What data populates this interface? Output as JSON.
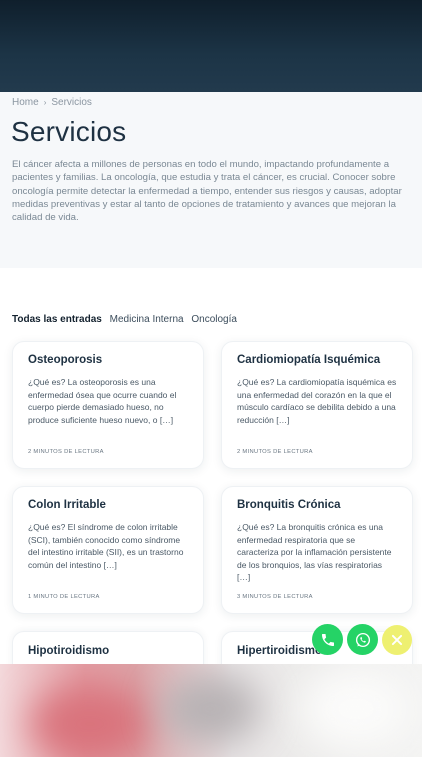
{
  "breadcrumb": {
    "home": "Home",
    "current": "Servicios"
  },
  "page": {
    "title": "Servicios",
    "description": "El cáncer afecta a millones de personas en todo el mundo, impactando profundamente a pacientes y familias. La oncología, que estudia y trata el cáncer, es crucial. Conocer sobre oncología permite detectar la enfermedad a tiempo, entender sus riesgos y causas, adoptar medidas preventivas y estar al tanto de opciones de tratamiento y avances que mejoran la calidad de vida."
  },
  "filters": {
    "all": "Todas las entradas",
    "tab1": "Medicina Interna",
    "tab2": "Oncología"
  },
  "cards": [
    {
      "title": "Osteoporosis",
      "excerpt": "¿Qué es? La osteoporosis  es una enfermedad ósea que ocurre cuando el cuerpo pierde demasiado hueso, no produce suficiente hueso nuevo, o […]",
      "meta": "2 MINUTOS DE LECTURA"
    },
    {
      "title": "Cardiomiopatía Isquémica",
      "excerpt": "¿Qué es? La cardiomiopatía isquémica es una enfermedad del corazón en la que el músculo cardíaco se debilita debido a una reducción […]",
      "meta": "2 MINUTOS DE LECTURA"
    },
    {
      "title": "Colon Irritable",
      "excerpt": "¿Qué es? El síndrome de colon irritable (SCI), también conocido como síndrome del intestino irritable (SII), es un trastorno común del intestino […]",
      "meta": "1 MINUTO DE LECTURA"
    },
    {
      "title": "Bronquitis Crónica",
      "excerpt": "¿Qué es? La bronquitis crónica es una enfermedad respiratoria que se caracteriza por la inflamación persistente de los bronquios, las vías respiratorias […]",
      "meta": "3 MINUTOS DE LECTURA"
    },
    {
      "title": "Hipotiroidismo"
    },
    {
      "title": "Hipertiroidismo"
    }
  ],
  "icons": {
    "phone": "phone-icon",
    "whatsapp": "whatsapp-icon",
    "close": "close-icon",
    "separator": "chevron-right-icon"
  },
  "colors": {
    "whatsapp_green": "#25d366",
    "close_yellow": "#eef06a",
    "title_dark": "#1e3142"
  }
}
